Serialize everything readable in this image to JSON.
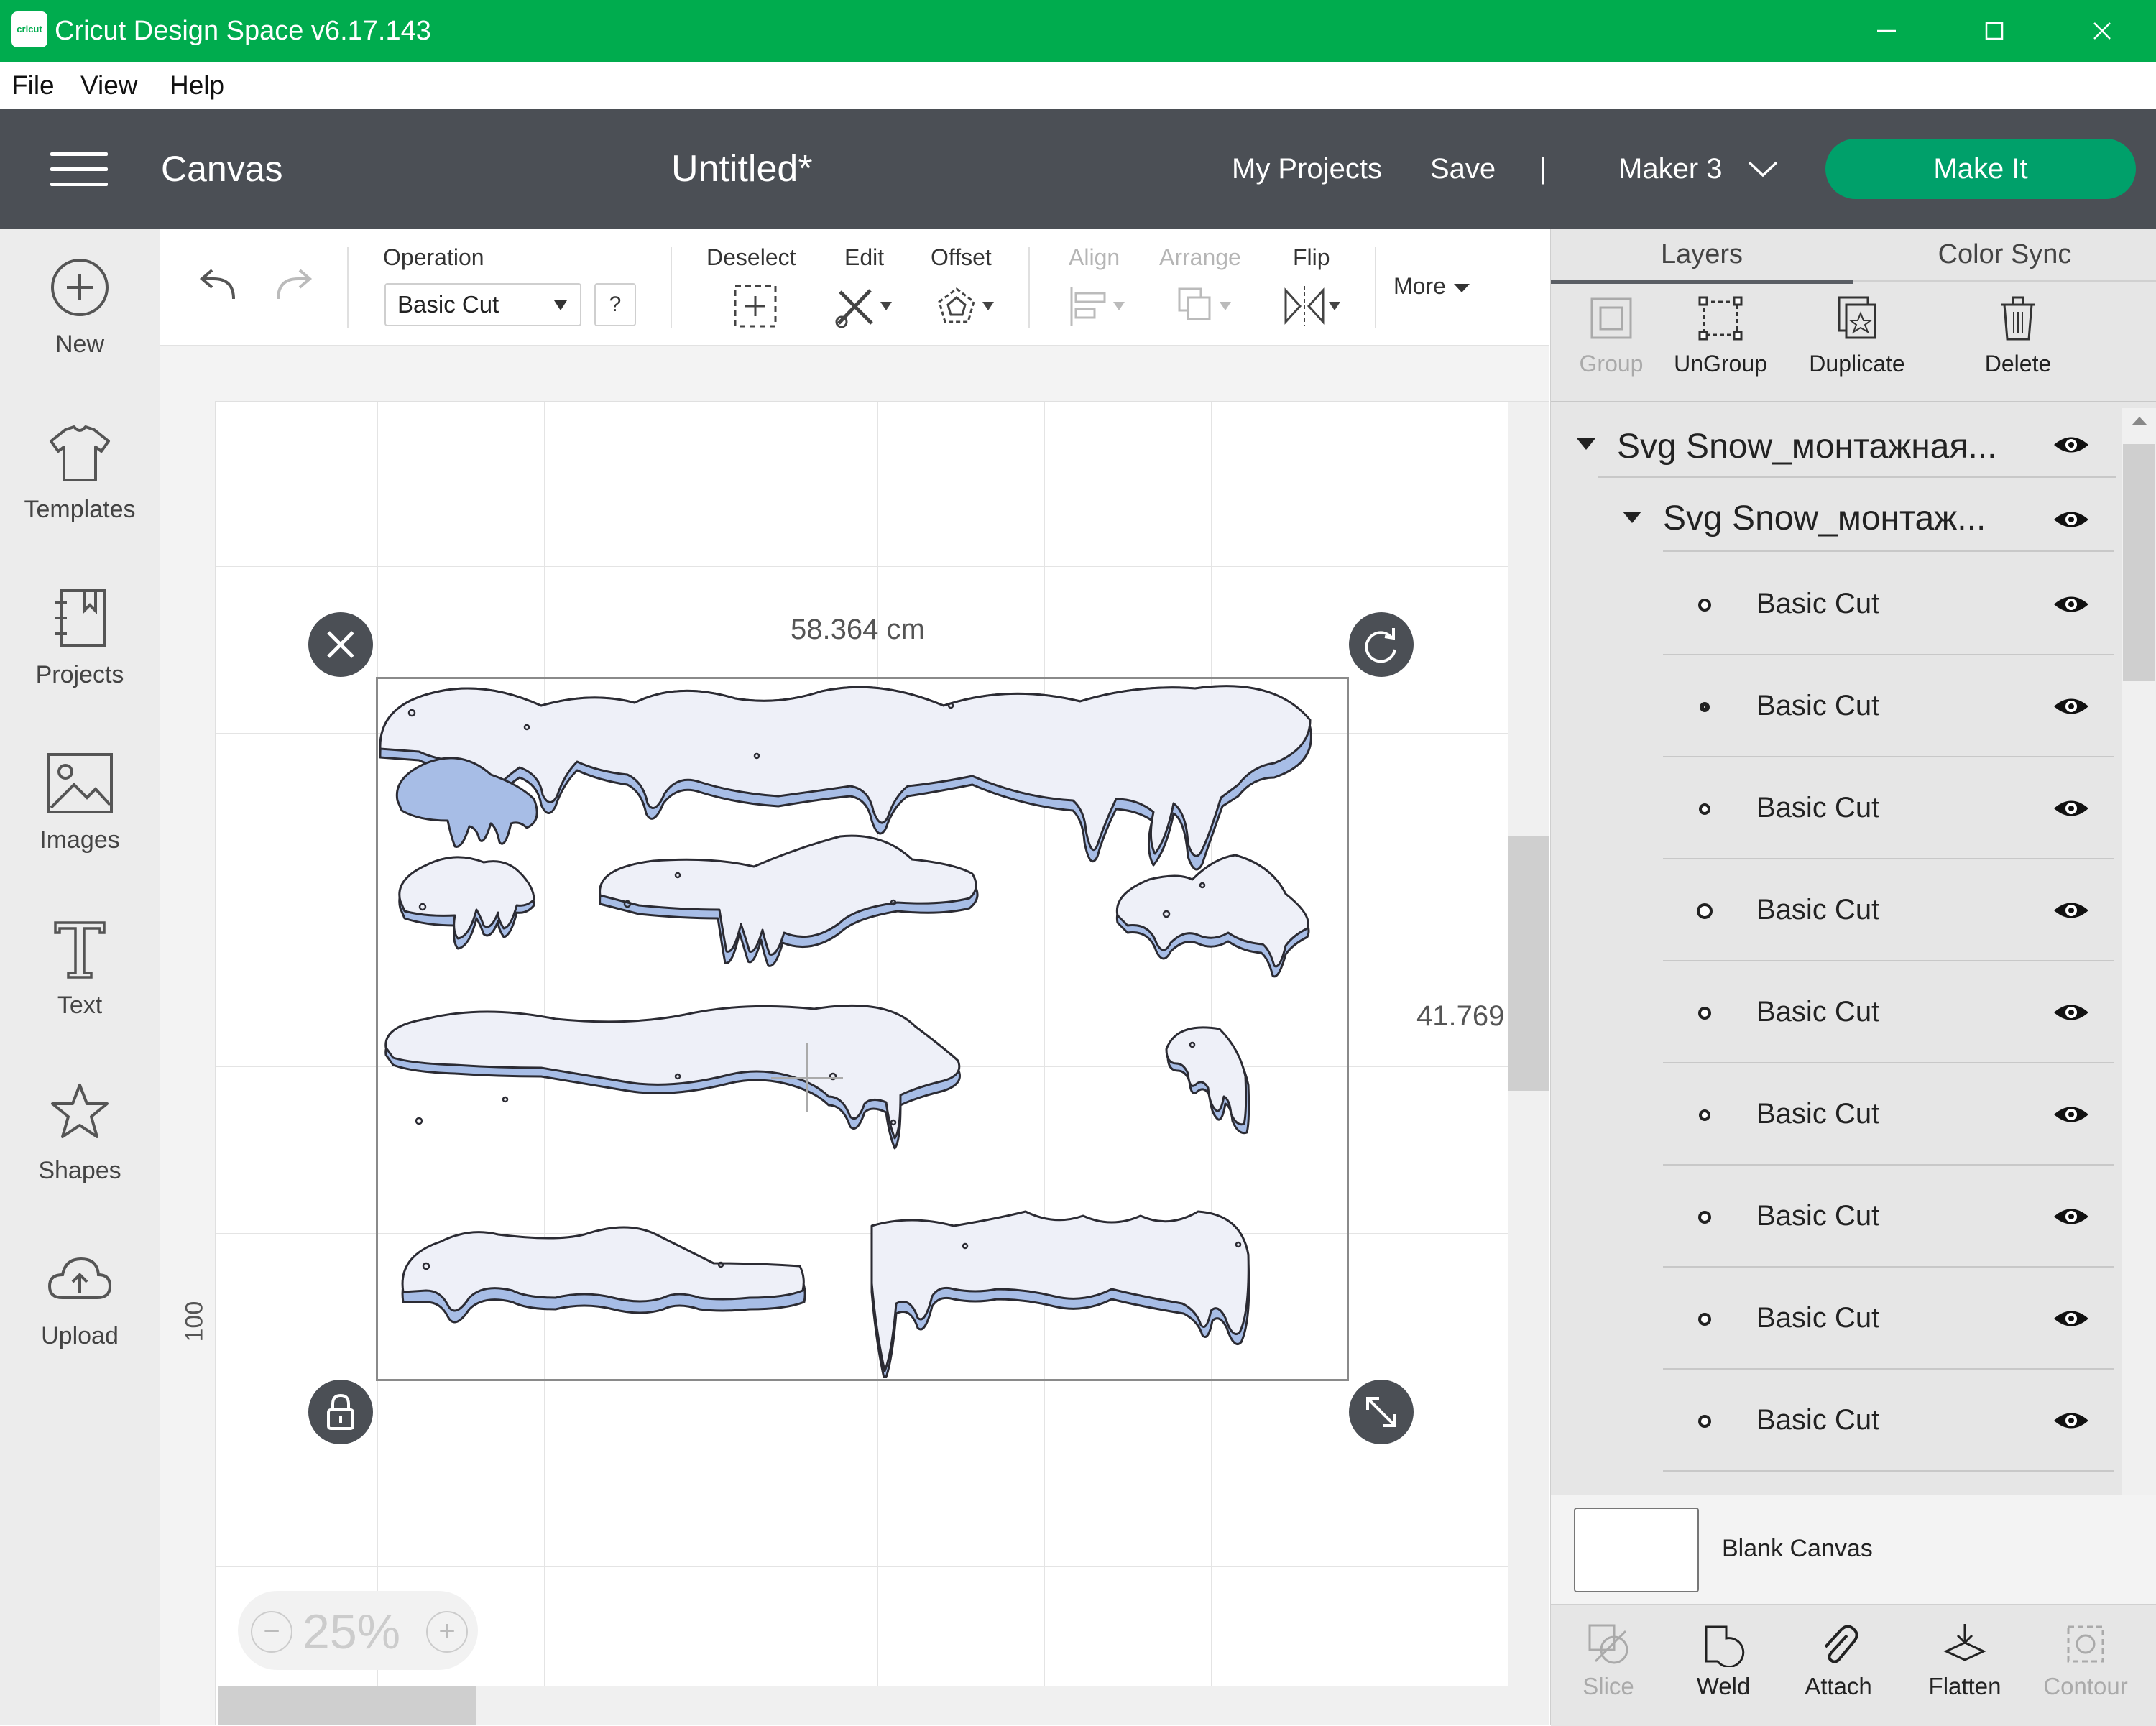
{
  "window": {
    "logo_text": "cricut",
    "title": "Cricut Design Space  v6.17.143",
    "minimize_icon": "minimize-icon",
    "maximize_icon": "maximize-icon",
    "close_icon": "close-icon"
  },
  "menu": {
    "file": "File",
    "view": "View",
    "help": "Help"
  },
  "header": {
    "section": "Canvas",
    "doc_title": "Untitled*",
    "my_projects": "My Projects",
    "save": "Save",
    "divider": "|",
    "machine": "Maker 3",
    "make_it": "Make It"
  },
  "sidebar": {
    "items": [
      {
        "label": "New",
        "icon": "plus-circle-icon"
      },
      {
        "label": "Templates",
        "icon": "tshirt-icon"
      },
      {
        "label": "Projects",
        "icon": "notebook-icon"
      },
      {
        "label": "Images",
        "icon": "image-icon"
      },
      {
        "label": "Text",
        "icon": "text-icon"
      },
      {
        "label": "Shapes",
        "icon": "shapes-icon"
      },
      {
        "label": "Upload",
        "icon": "cloud-upload-icon"
      }
    ]
  },
  "toolbar": {
    "operation_label": "Operation",
    "operation_value": "Basic Cut",
    "help": "?",
    "deselect": "Deselect",
    "edit": "Edit",
    "offset": "Offset",
    "align": "Align",
    "arrange": "Arrange",
    "flip": "Flip",
    "more": "More"
  },
  "canvas": {
    "width_label": "58.364 cm",
    "height_label": "41.769",
    "ruler_label": "100",
    "zoom": "25%",
    "zoom_minus": "−",
    "zoom_plus": "+"
  },
  "panel": {
    "tabs": {
      "layers": "Layers",
      "color_sync": "Color Sync"
    },
    "actions": {
      "group": "Group",
      "ungroup": "UnGroup",
      "duplicate": "Duplicate",
      "delete": "Delete"
    },
    "group_name": "Svg Snow_монтажная...",
    "subgroup_name": "Svg Snow_монтаж...",
    "layers": [
      "Basic Cut",
      "Basic Cut",
      "Basic Cut",
      "Basic Cut",
      "Basic Cut",
      "Basic Cut",
      "Basic Cut",
      "Basic Cut",
      "Basic Cut"
    ],
    "blank_canvas": "Blank Canvas",
    "bottom": {
      "slice": "Slice",
      "weld": "Weld",
      "attach": "Attach",
      "flatten": "Flatten",
      "contour": "Contour"
    }
  },
  "colors": {
    "titlebar": "#00ac4e",
    "header": "#4b4f55",
    "make_it": "#00a06a",
    "snow_fill": "#eef0f8",
    "snow_shadow": "#a7bde6",
    "handle": "#4b4f55"
  }
}
